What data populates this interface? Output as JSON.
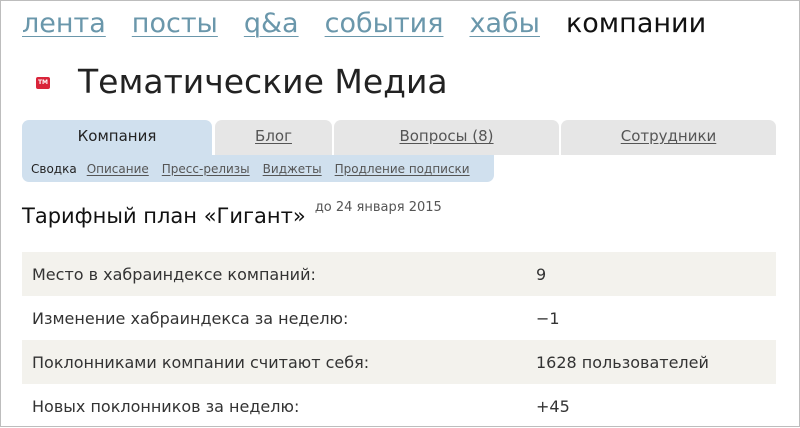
{
  "nav": {
    "items": [
      {
        "label": "лента"
      },
      {
        "label": "посты"
      },
      {
        "label": "q&a"
      },
      {
        "label": "события"
      },
      {
        "label": "хабы"
      }
    ],
    "active": "компании"
  },
  "company": {
    "icon": "tm-logo-icon",
    "icon_text": "TM",
    "name": "Тематические Медиа"
  },
  "tabs": [
    {
      "label": "Компания",
      "active": true
    },
    {
      "label": "Блог"
    },
    {
      "label": "Вопросы (8)"
    },
    {
      "label": "Сотрудники"
    }
  ],
  "subtabs": {
    "current": "Сводка",
    "links": [
      "Описание",
      "Пресс-релизы",
      "Виджеты",
      "Продление подписки"
    ]
  },
  "plan": {
    "title": "Тарифный план «Гигант»",
    "until": "до 24 января 2015"
  },
  "stats": [
    {
      "label": "Место в хабраиндексе компаний:",
      "value": "9"
    },
    {
      "label": "Изменение хабраиндекса за неделю:",
      "value": "−1"
    },
    {
      "label": "Поклонниками компании считают себя:",
      "value": "1628 пользователей"
    },
    {
      "label": "Новых поклонников за неделю:",
      "value": "+45"
    }
  ],
  "colors": {
    "link": "#6a97ab",
    "tab_active": "#d0e0ee",
    "tab_inactive": "#e6e6e6",
    "row_shaded": "#f3f2ed",
    "icon_red": "#d9243a"
  }
}
